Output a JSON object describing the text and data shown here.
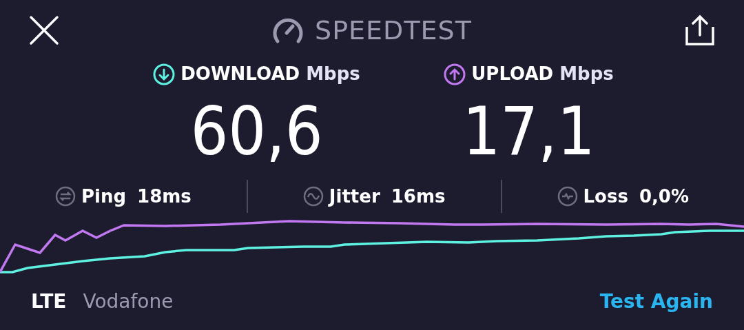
{
  "header": {
    "title": "SPEEDTEST"
  },
  "results": [
    {
      "kind": "download",
      "label": "DOWNLOAD",
      "unit": "Mbps",
      "value": "60,6",
      "color": "#5ef0e0"
    },
    {
      "kind": "upload",
      "label": "UPLOAD",
      "unit": "Mbps",
      "value": "17,1",
      "color": "#c278f0"
    }
  ],
  "metrics": [
    {
      "kind": "ping",
      "label": "Ping",
      "value": "18ms"
    },
    {
      "kind": "jitter",
      "label": "Jitter",
      "value": "16ms"
    },
    {
      "kind": "loss",
      "label": "Loss",
      "value": "0,0%"
    }
  ],
  "network": {
    "type": "LTE",
    "carrier": "Vodafone"
  },
  "action": {
    "label": "Test Again"
  }
}
